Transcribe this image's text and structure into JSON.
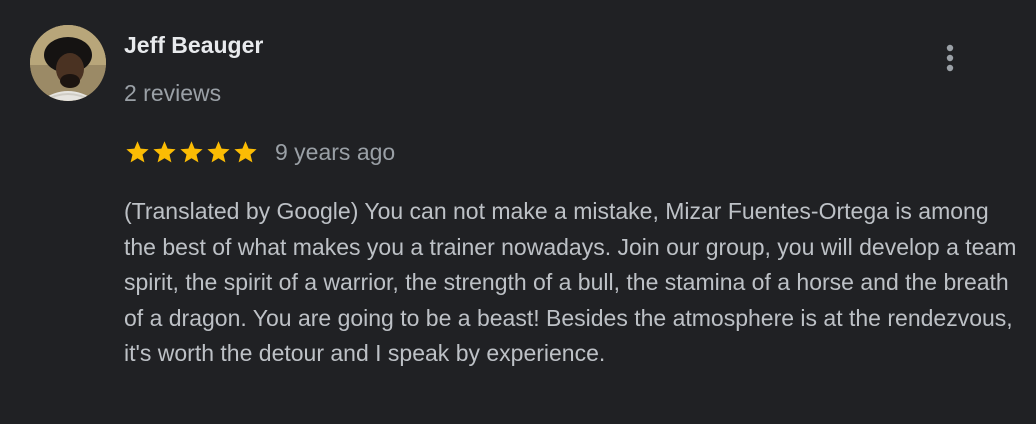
{
  "review": {
    "author_name": "Jeff Beauger",
    "review_count": "2 reviews",
    "rating": 5,
    "rating_max": 5,
    "time_ago": "9 years ago",
    "text": "(Translated by Google) You can not make a mistake, Mizar Fuentes-Ortega is among the best of what makes you a trainer nowadays. Join our group, you will develop a team spirit, the spirit of a warrior, the strength of a bull, the stamina of a horse and the breath of a dragon. You are going to be a beast! Besides the atmosphere is at the rendezvous, it's worth the detour and I speak by experience."
  },
  "icons": {
    "menu": "more-vertical-icon",
    "star": "star-icon",
    "avatar": "user-avatar"
  },
  "colors": {
    "background": "#202124",
    "star": "#fbbc04",
    "name": "#e8eaed",
    "secondary": "#9aa0a6",
    "body_text": "#bdc1c6"
  }
}
